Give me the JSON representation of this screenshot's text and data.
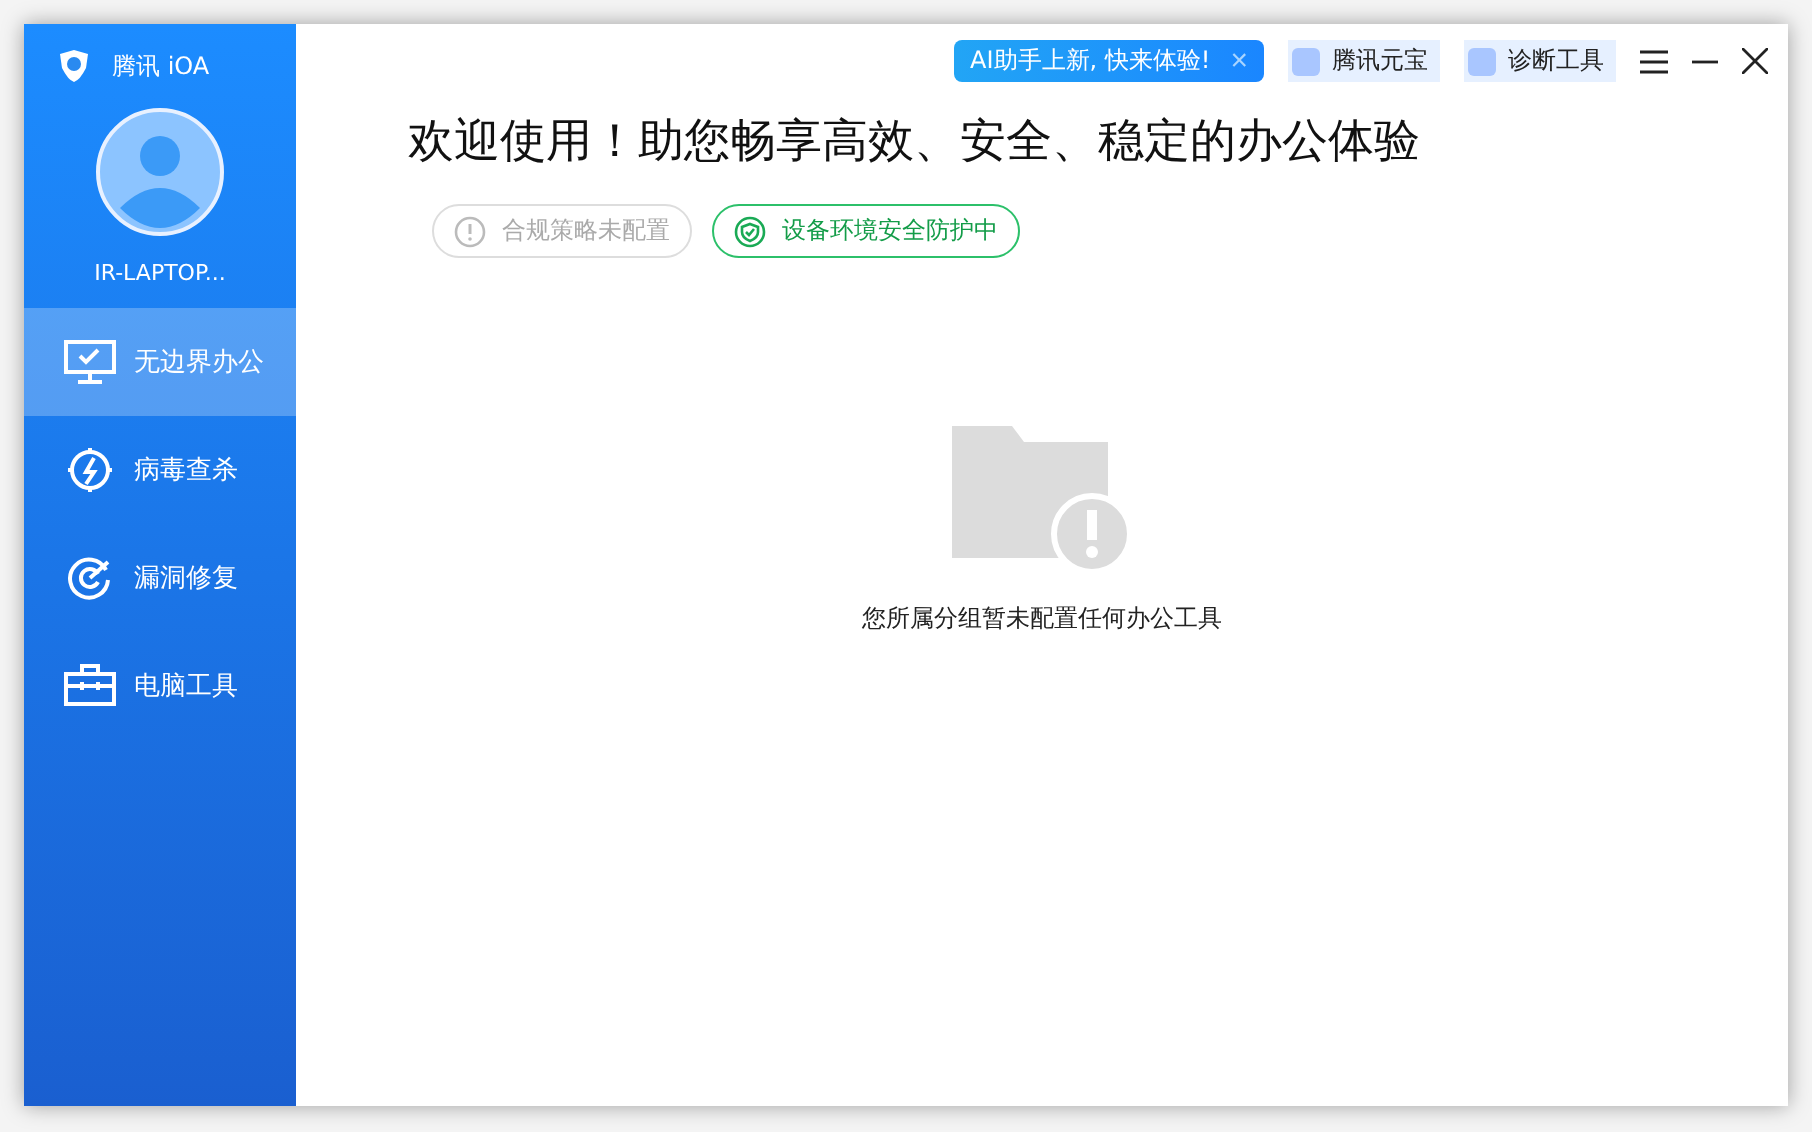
{
  "sidebar": {
    "brand": "腾讯 iOA",
    "user": "IR-LAPTOP...",
    "items": [
      {
        "label": "无边界办公",
        "selected": true
      },
      {
        "label": "病毒查杀",
        "selected": false
      },
      {
        "label": "漏洞修复",
        "selected": false
      },
      {
        "label": "电脑工具",
        "selected": false
      }
    ]
  },
  "topbar": {
    "promo": "AI助手上新, 快来体验!",
    "promo_close": "×",
    "links": [
      "腾讯元宝",
      "诊断工具"
    ]
  },
  "heading": "欢迎使用！助您畅享高效、安全、稳定的办公体验",
  "badges": [
    {
      "label": "合规策略未配置",
      "kind": "warn"
    },
    {
      "label": "设备环境安全防护中",
      "kind": "ok"
    }
  ],
  "empty_message": "您所属分组暂未配置任何办公工具"
}
